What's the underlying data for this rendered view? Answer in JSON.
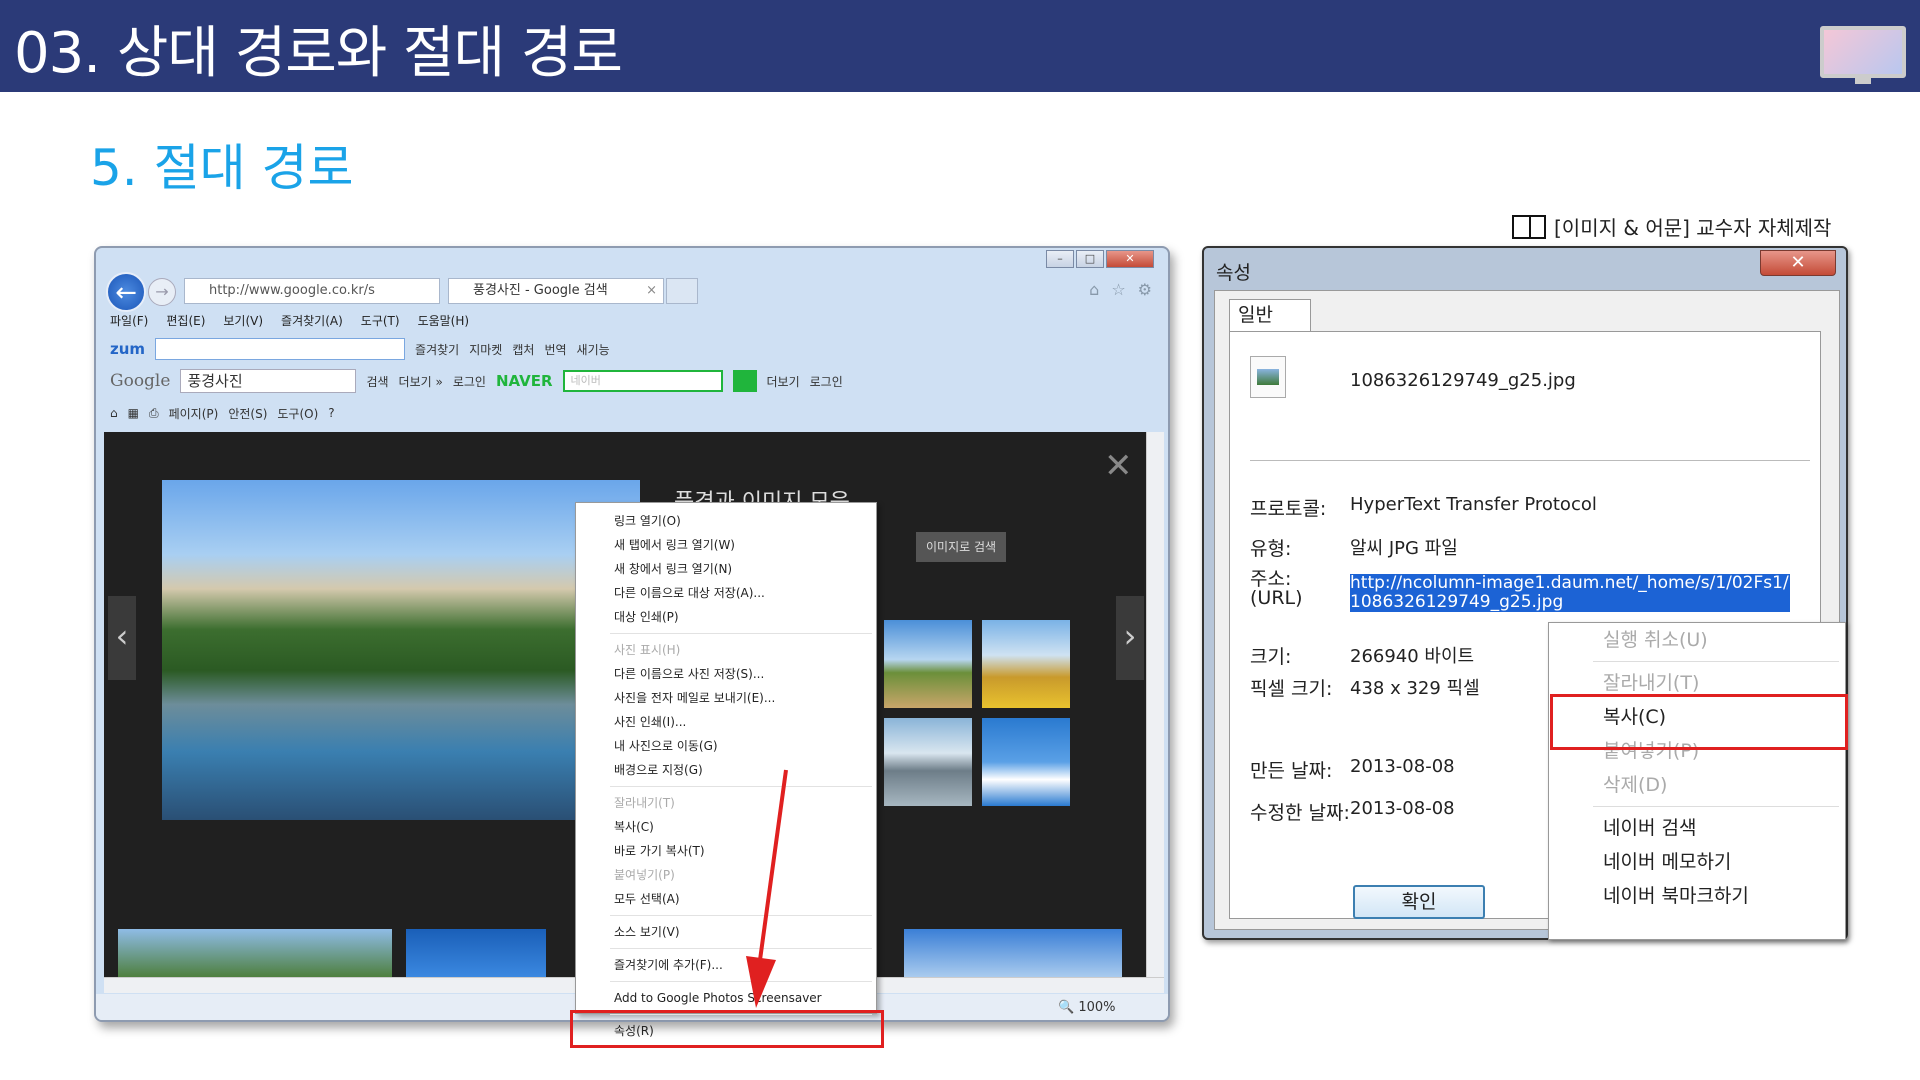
{
  "header": {
    "title": "03. 상대 경로와 절대 경로",
    "subtitle": "5. 절대 경로",
    "credit": "[이미지 & 어문] 교수자 자체제작"
  },
  "browser": {
    "address": "http://www.google.co.kr/s",
    "tab_label": "풍경사진 - Google 검색",
    "menu": [
      "파일(F)",
      "편집(E)",
      "보기(V)",
      "즐겨찾기(A)",
      "도구(T)",
      "도움말(H)"
    ],
    "toolbar1": {
      "zum": "zum",
      "zumbox_text": "",
      "favorites": "즐겨찾기",
      "map": "지마켓",
      "capture": "캡처",
      "translate": "번역",
      "new": "새기능"
    },
    "toolbar2": {
      "google": "Google",
      "search_value": "풍경사진",
      "search": "검색",
      "more": "더보기 »",
      "login": "로그인",
      "naver": "NAVER",
      "naver_placeholder": "네이버",
      "more2": "더보기",
      "login2": "로그인"
    },
    "toolbar3": {
      "page": "페이지(P)",
      "safety": "안전(S)",
      "tools": "도구(O)"
    },
    "panel": {
      "title": "풍경과 이미지 모음",
      "btn_search_by_image": "이미지로 검색"
    },
    "zoom": "100%",
    "context_menu": [
      {
        "label": "링크 열기(O)",
        "disabled": false
      },
      {
        "label": "새 탭에서 링크 열기(W)",
        "disabled": false
      },
      {
        "label": "새 창에서 링크 열기(N)",
        "disabled": false
      },
      {
        "label": "다른 이름으로 대상 저장(A)...",
        "disabled": false
      },
      {
        "label": "대상 인쇄(P)",
        "disabled": false
      },
      {
        "sep": true
      },
      {
        "label": "사진 표시(H)",
        "disabled": true
      },
      {
        "label": "다른 이름으로 사진 저장(S)...",
        "disabled": false
      },
      {
        "label": "사진을 전자 메일로 보내기(E)...",
        "disabled": false
      },
      {
        "label": "사진 인쇄(I)...",
        "disabled": false
      },
      {
        "label": "내 사진으로 이동(G)",
        "disabled": false
      },
      {
        "label": "배경으로 지정(G)",
        "disabled": false
      },
      {
        "sep": true
      },
      {
        "label": "잘라내기(T)",
        "disabled": true
      },
      {
        "label": "복사(C)",
        "disabled": false
      },
      {
        "label": "바로 가기 복사(T)",
        "disabled": false
      },
      {
        "label": "붙여넣기(P)",
        "disabled": true
      },
      {
        "label": "모두 선택(A)",
        "disabled": false
      },
      {
        "sep": true
      },
      {
        "label": "소스 보기(V)",
        "disabled": false
      },
      {
        "sep": true
      },
      {
        "label": "즐겨찾기에 추가(F)...",
        "disabled": false
      },
      {
        "sep": true
      },
      {
        "label": "Add to Google Photos Screensaver",
        "disabled": false
      },
      {
        "sep": true
      },
      {
        "label": "속성(R)",
        "disabled": false
      }
    ]
  },
  "dialog": {
    "title": "속성",
    "tab": "일반",
    "filename": "1086326129749_g25.jpg",
    "protocol_label": "프로토콜:",
    "protocol_value": "HyperText Transfer Protocol",
    "type_label": "유형:",
    "type_value": "알씨 JPG 파일",
    "address_label": "주소:",
    "address_label2": "(URL)",
    "address_value": "http://ncolumn-image1.daum.net/_home/s/1/02Fs1/1086326129749_g25.jpg",
    "size_label": "크기:",
    "size_value": "266940 바이트",
    "dims_label": "픽셀 크기:",
    "dims_value": "438  x  329  픽셀",
    "created_label": "만든 날짜:",
    "created_value": "2013-08-08",
    "modified_label": "수정한 날짜:",
    "modified_value": "2013-08-08",
    "ok": "확인",
    "context_menu": [
      {
        "label": "실행 취소(U)",
        "disabled": true
      },
      {
        "sep": true
      },
      {
        "label": "잘라내기(T)",
        "disabled": true
      },
      {
        "label": "복사(C)",
        "disabled": false
      },
      {
        "label": "붙여넣기(P)",
        "disabled": true
      },
      {
        "label": "삭제(D)",
        "disabled": true
      },
      {
        "sep": true
      },
      {
        "label": "네이버 검색",
        "disabled": false
      },
      {
        "label": "네이버 메모하기",
        "disabled": false
      },
      {
        "label": "네이버 북마크하기",
        "disabled": false
      }
    ]
  },
  "colors": {
    "header_bg": "#2b3a78",
    "subtitle": "#1aa3e8",
    "highlight": "#e02020",
    "url_select": "#1c63d5"
  }
}
